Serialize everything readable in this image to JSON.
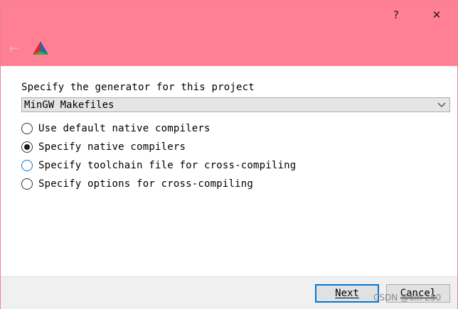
{
  "titlebar": {
    "help_label": "?",
    "close_label": "✕",
    "back_label": "←",
    "logo_icon": "cmake-logo",
    "color": "#ff8093"
  },
  "generator": {
    "prompt": "Specify the generator for this project",
    "selected": "MinGW Makefiles"
  },
  "options": [
    {
      "label": "Use default native compilers",
      "checked": false
    },
    {
      "label": "Specify native compilers",
      "checked": true
    },
    {
      "label": "Specify toolchain file for cross-compiling",
      "checked": false,
      "focused": true
    },
    {
      "label": "Specify options for cross-compiling",
      "checked": false
    }
  ],
  "footer": {
    "next_label": "Next",
    "cancel_label": "Cancel",
    "watermark": "CSDN @6in 250"
  },
  "colors": {
    "accent": "#0078d7"
  }
}
